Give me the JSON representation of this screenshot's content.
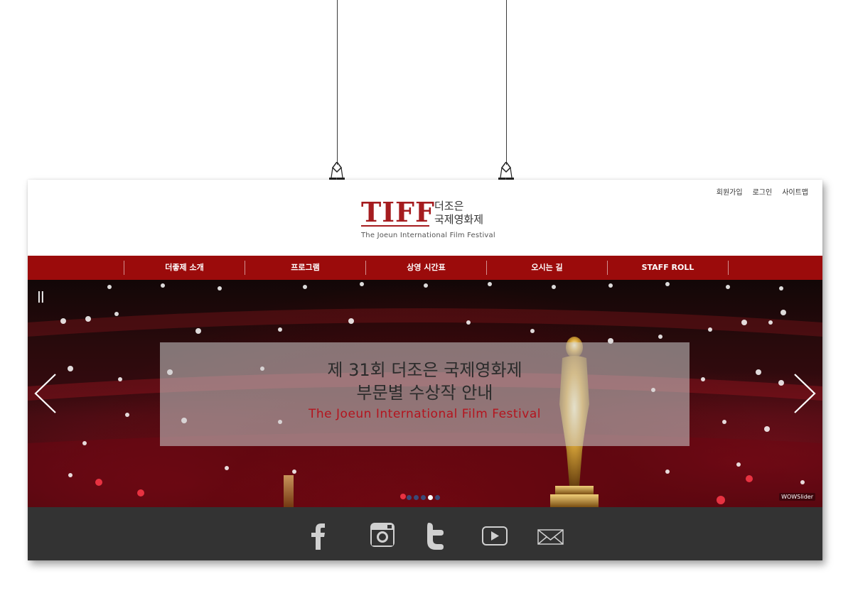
{
  "util_nav": {
    "join": "회원가입",
    "login": "로그인",
    "sitemap": "사이트맵"
  },
  "logo": {
    "mark": "TIFF",
    "ko_line1": "더조은",
    "ko_line2": "국제영화제",
    "en": "The Joeun International Film Festival"
  },
  "gnb": {
    "items": [
      "더좋제 소개",
      "프로그램",
      "상영 시간표",
      "오시는 길",
      "STAFF ROLL"
    ]
  },
  "slider": {
    "pause_label": "||",
    "caption_line1": "제 31회 더조은 국제영화제",
    "caption_line2": "부문별 수상작 안내",
    "caption_line3": "The Joeun International Film Festival",
    "slide_count": 5,
    "active_slide": 4,
    "watermark": "WOWSlider"
  },
  "footer": {
    "icons": [
      "facebook-icon",
      "instagram-icon",
      "twitter-icon",
      "youtube-icon",
      "mail-icon"
    ]
  },
  "colors": {
    "brand_red": "#a51c1f",
    "nav_red": "#9b0b0b",
    "footer_gray": "#333333"
  }
}
